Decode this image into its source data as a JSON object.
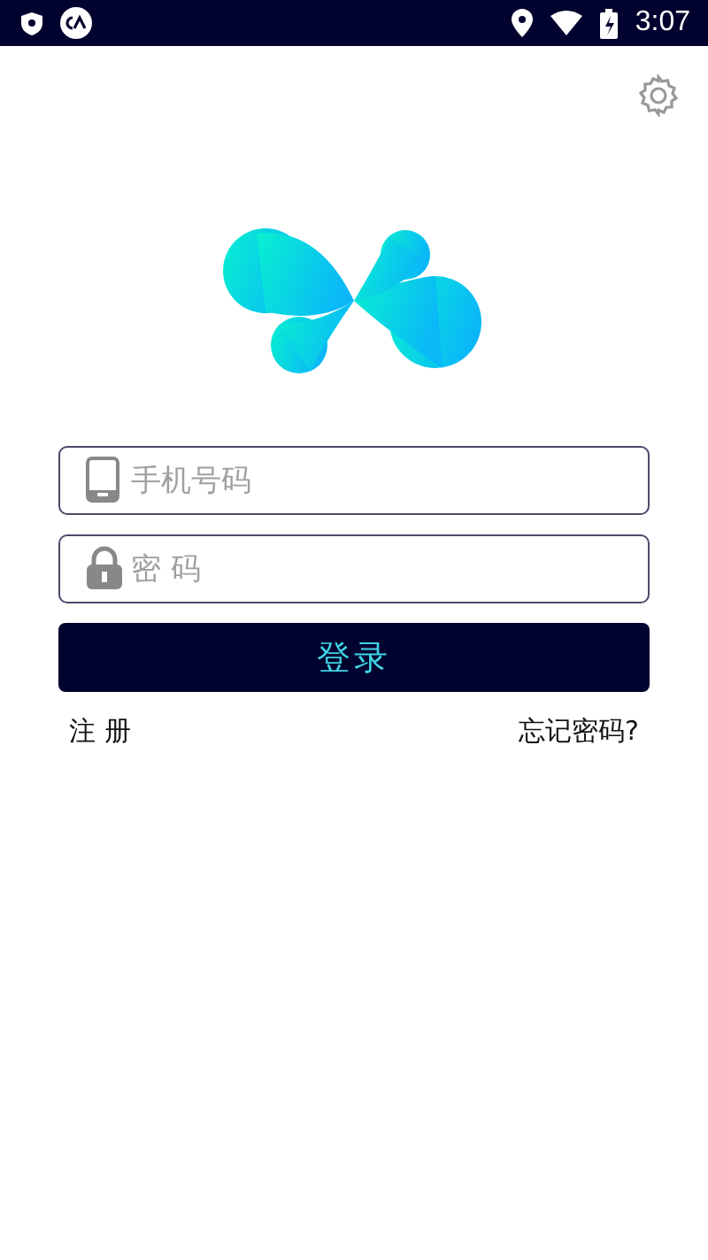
{
  "status_bar": {
    "time": "3:07"
  },
  "login_form": {
    "fields": [
      {
        "kind": "phone",
        "placeholder": "手机号码"
      },
      {
        "kind": "password",
        "placeholder": "密 码"
      }
    ],
    "submit_button": "登录",
    "register_link": "注 册",
    "forgot_link": "忘记密码?"
  }
}
